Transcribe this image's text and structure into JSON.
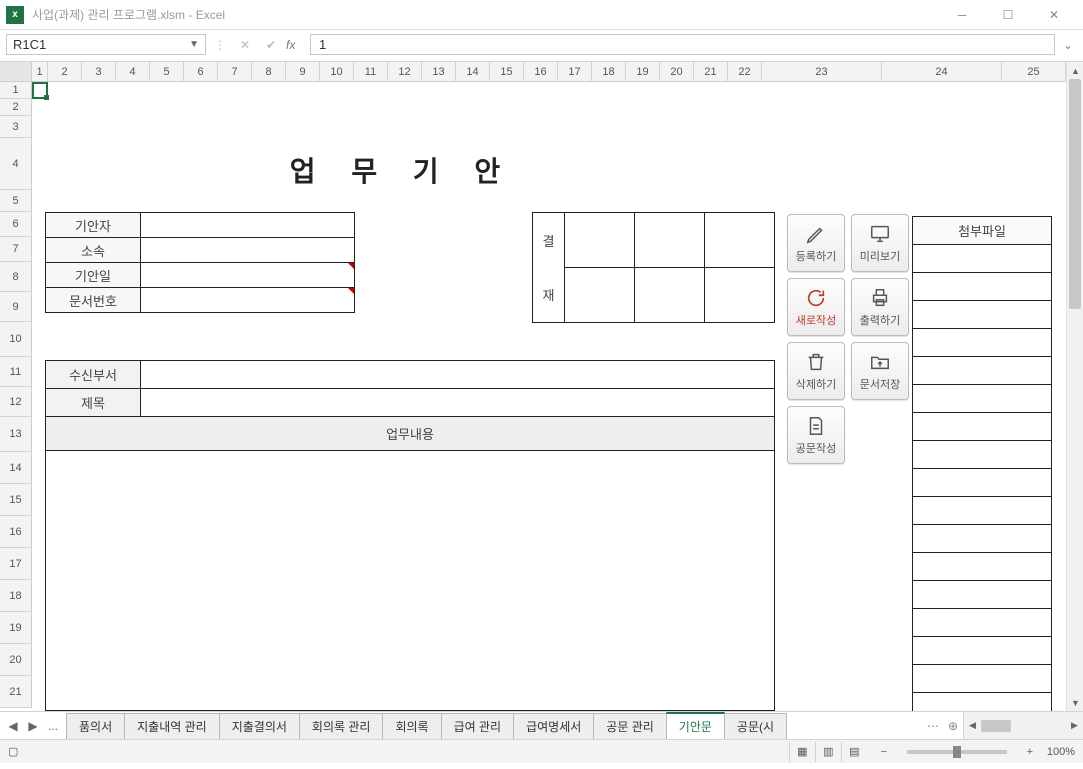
{
  "window": {
    "title": "사업(과제) 관리 프로그램.xlsm - Excel",
    "app_icon_text": "x"
  },
  "formula_bar": {
    "name_box": "R1C1",
    "fx_label": "fx",
    "formula": "1"
  },
  "column_headers": [
    "1",
    "2",
    "3",
    "4",
    "5",
    "6",
    "7",
    "8",
    "9",
    "10",
    "11",
    "12",
    "13",
    "14",
    "15",
    "16",
    "17",
    "18",
    "19",
    "20",
    "21",
    "22",
    "23",
    "24",
    "25"
  ],
  "row_headers": [
    "1",
    "2",
    "3",
    "4",
    "5",
    "6",
    "7",
    "8",
    "9",
    "10",
    "11",
    "12",
    "13",
    "14",
    "15",
    "16",
    "17",
    "18",
    "19",
    "20",
    "21"
  ],
  "document": {
    "title": "업 무 기 안",
    "info_labels": {
      "drafter": "기안자",
      "dept": "소속",
      "date": "기안일",
      "docno": "문서번호"
    },
    "approval_label_top": "결",
    "approval_label_bottom": "재",
    "mid_labels": {
      "recipient": "수신부서",
      "subject": "제목",
      "content_header": "업무내용"
    },
    "attach_header": "첨부파일"
  },
  "buttons": {
    "register": "등록하기",
    "preview": "미리보기",
    "new": "새로작성",
    "print": "출력하기",
    "delete": "삭제하기",
    "save": "문서저장",
    "draft": "공문작성"
  },
  "sheet_tabs": {
    "more": "...",
    "tabs": [
      "품의서",
      "지출내역 관리",
      "지출결의서",
      "회의록 관리",
      "회의록",
      "급여 관리",
      "급여명세서",
      "공문 관리",
      "기안문",
      "공문(시"
    ],
    "active_index": 8
  },
  "statusbar": {
    "zoom": "100%"
  }
}
